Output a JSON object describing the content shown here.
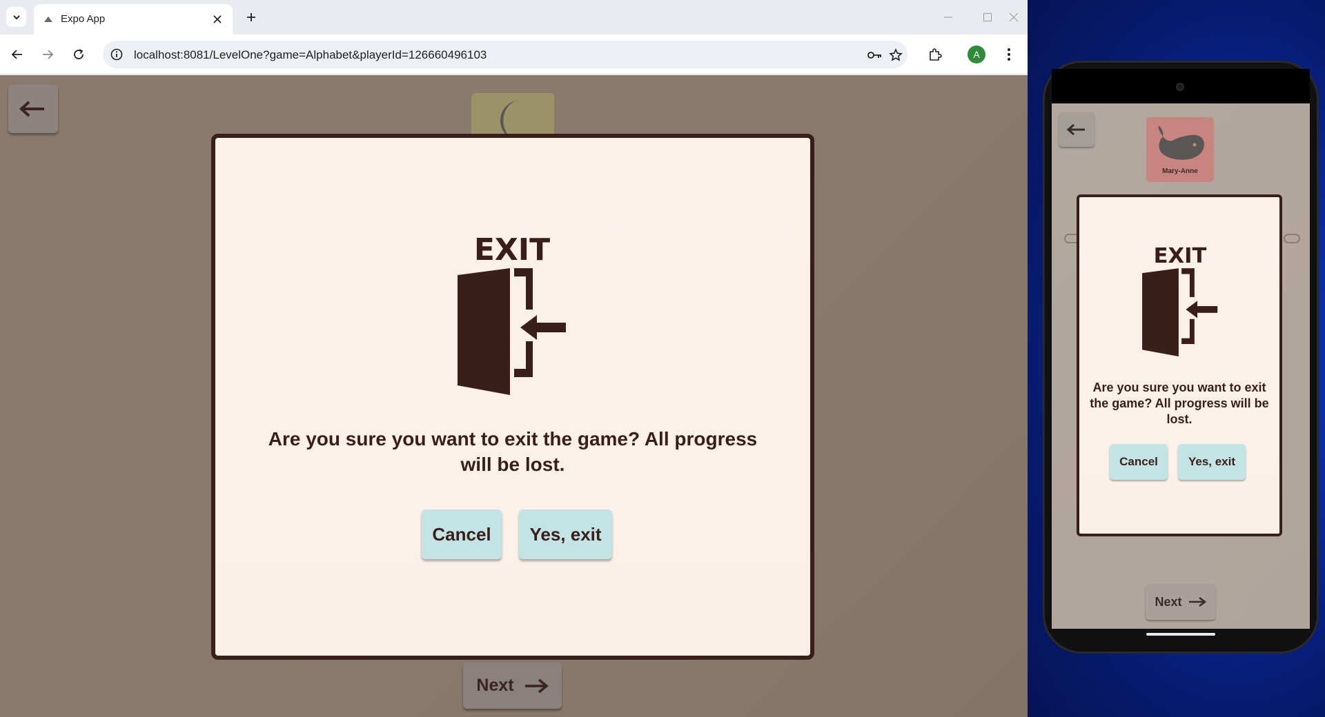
{
  "browser": {
    "tab": {
      "title": "Expo App"
    },
    "address_bar": {
      "url": "localhost:8081/LevelOne?game=Alphabet&playerId=126660496103"
    },
    "profile_initial": "A"
  },
  "web_app": {
    "next_label": "Next",
    "dialog": {
      "icon_text": "EXIT",
      "message": "Are you sure you want to exit the game? All progress will be lost.",
      "cancel_label": "Cancel",
      "confirm_label": "Yes, exit"
    }
  },
  "phone_app": {
    "card_label": "Mary-Anne",
    "next_label": "Next",
    "dialog": {
      "icon_text": "EXIT",
      "message": "Are you sure you want to exit the game? All progress will be lost.",
      "cancel_label": "Cancel",
      "confirm_label": "Yes, exit"
    }
  },
  "colors": {
    "dialog_border": "#3a1e1a",
    "dialog_bg": "#fdf1ec",
    "button_bg": "#c3e3e5",
    "text_dark": "#3a1e1a"
  }
}
